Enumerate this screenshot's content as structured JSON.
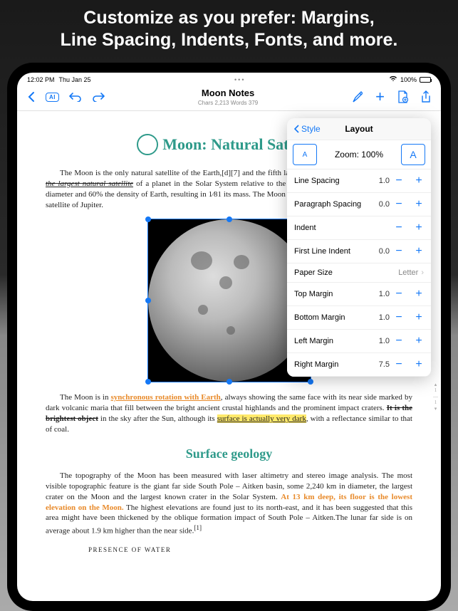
{
  "promo": {
    "line1": "Customize as you prefer: Margins,",
    "line2": "Line Spacing, Indents, Fonts, and more."
  },
  "statusbar": {
    "time": "12:02 PM",
    "date": "Thu Jan 25",
    "battery": "100%"
  },
  "toolbar": {
    "ai_label": "AI",
    "title": "Moon Notes",
    "stats": "Chars 2,213 Words 379"
  },
  "popover": {
    "back_label": "Style",
    "title": "Layout",
    "zoom_label": "Zoom: 100%",
    "rows": [
      {
        "label": "Line Spacing",
        "value": "1.0"
      },
      {
        "label": "Paragraph Spacing",
        "value": "0.0"
      },
      {
        "label": "Indent",
        "value": ""
      },
      {
        "label": "First Line Indent",
        "value": "0.0"
      }
    ],
    "paper_label": "Paper Size",
    "paper_value": "Letter",
    "margins": [
      {
        "label": "Top Margin",
        "value": "1.0"
      },
      {
        "label": "Bottom Margin",
        "value": "1.0"
      },
      {
        "label": "Left Margin",
        "value": "1.0"
      },
      {
        "label": "Right Margin",
        "value": "7.5"
      }
    ]
  },
  "document": {
    "h1": "Moon: Natural Satellite",
    "p1_a": "The Moon is the only natural satellite of the Earth,[d][7] and the fifth largest satellite in the Solar System. ",
    "p1_b": "It is the largest natural satellite",
    "p1_c": " of a planet in the Solar System relative to the size of its primary,[e] having 27% the diameter and 60% the density of Earth, resulting in 1⁄81 its mass. The Moon is the second densest satellite after Io, a satellite of Jupiter.",
    "p2_a": "The Moon is in ",
    "p2_b": "synchronous rotation with Earth",
    "p2_c": ", always showing the same face with its near side marked by dark volcanic maria that fill between the bright ancient crustal highlands and the prominent impact craters. ",
    "p2_d": "It is the brightest object",
    "p2_e": " in the sky after the Sun, although its ",
    "p2_f": "surface is actually very dark",
    "p2_g": ", with a reflectance similar to that of coal.",
    "h2": "Surface geology",
    "p3_a": "The topography of the Moon has been measured with laser altimetry and stereo image analysis. The most visible topographic feature is the giant far side South Pole – Aitken basin, some 2,240 km in diameter, the largest crater on the Moon and the largest known crater in the Solar System. ",
    "p3_b": "At 13 km deep, its floor is the lowest elevation on the Moon.",
    "p3_c": " The highest elevations are found just to its north-east, and it has been suggested that this area might have been thickened by the oblique formation impact of South Pole – Aitken.The lunar far side is on average about 1.9 km higher than the near side.",
    "p3_d": "[1]",
    "caption": "PRESENCE OF WATER"
  }
}
